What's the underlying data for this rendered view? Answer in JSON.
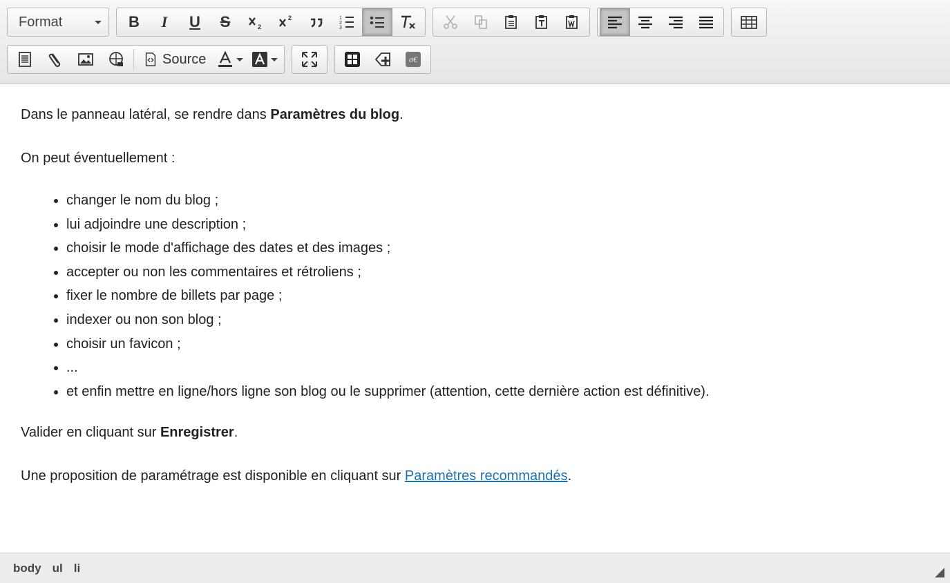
{
  "toolbar": {
    "format_label": "Format",
    "source_label": "Source",
    "bold_label": "B",
    "italic_label": "I",
    "underline_label": "U",
    "strike_label": "S"
  },
  "content": {
    "p1_text": "Dans le panneau latéral, se rendre dans ",
    "p1_bold": "Paramètres du blog",
    "p1_end": ".",
    "p2": "On peut éventuellement :",
    "items": [
      "changer le nom du blog ;",
      "lui adjoindre une description ;",
      "choisir le mode d'affichage des dates et des images ;",
      "accepter ou non les commentaires et rétroliens ;",
      "fixer le nombre de billets par page ;",
      "indexer ou non son blog ;",
      "choisir un favicon ;",
      "...",
      "et enfin mettre en ligne/hors ligne son blog ou le supprimer (attention, cette dernière action est définitive)."
    ],
    "p3_text": "Valider en cliquant sur ",
    "p3_bold": "Enregistrer",
    "p3_end": ".",
    "p4_text": "Une proposition de paramétrage est disponible en cliquant sur ",
    "p4_link": "Paramètres recommandés",
    "p4_end": "."
  },
  "statusbar": {
    "path": [
      "body",
      "ul",
      "li"
    ]
  },
  "colors": {
    "link": "#1c73b4",
    "active_button": "#c4c4c4"
  }
}
